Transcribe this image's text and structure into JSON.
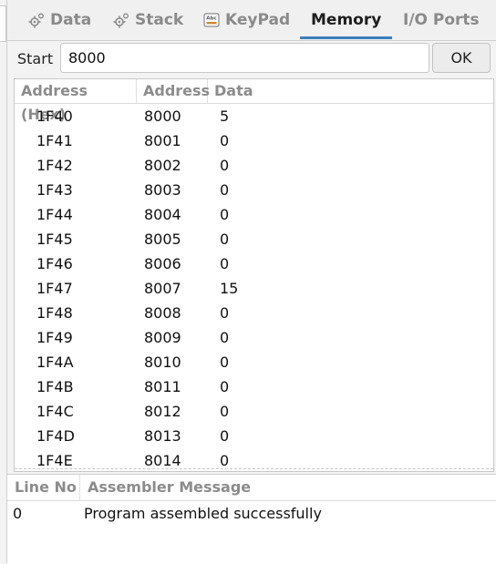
{
  "tabs": [
    {
      "label": "Data",
      "icon": "gear-icon",
      "active": false
    },
    {
      "label": "Stack",
      "icon": "gear-icon",
      "active": false
    },
    {
      "label": "KeyPad",
      "icon": "keypad-icon",
      "active": false
    },
    {
      "label": "Memory",
      "icon": "",
      "active": true
    },
    {
      "label": "I/O Ports",
      "icon": "",
      "active": false
    }
  ],
  "start": {
    "label": "Start",
    "value": "8000",
    "ok_label": "OK"
  },
  "memory_table": {
    "columns": [
      "Address (Hex)",
      "Address",
      "Data"
    ],
    "rows": [
      [
        "1F40",
        "8000",
        "5"
      ],
      [
        "1F41",
        "8001",
        "0"
      ],
      [
        "1F42",
        "8002",
        "0"
      ],
      [
        "1F43",
        "8003",
        "0"
      ],
      [
        "1F44",
        "8004",
        "0"
      ],
      [
        "1F45",
        "8005",
        "0"
      ],
      [
        "1F46",
        "8006",
        "0"
      ],
      [
        "1F47",
        "8007",
        "15"
      ],
      [
        "1F48",
        "8008",
        "0"
      ],
      [
        "1F49",
        "8009",
        "0"
      ],
      [
        "1F4A",
        "8010",
        "0"
      ],
      [
        "1F4B",
        "8011",
        "0"
      ],
      [
        "1F4C",
        "8012",
        "0"
      ],
      [
        "1F4D",
        "8013",
        "0"
      ],
      [
        "1F4E",
        "8014",
        "0"
      ]
    ]
  },
  "messages": {
    "columns": [
      "Line No",
      "Assembler Message"
    ],
    "rows": [
      [
        "0",
        "Program assembled successfully"
      ]
    ]
  },
  "colors": {
    "accent": "#3d7ebf",
    "inactive_tab": "#8a8a8a",
    "header_text": "#8c8c8c"
  }
}
